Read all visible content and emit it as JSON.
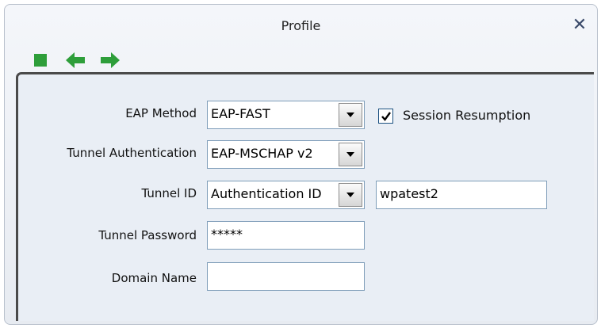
{
  "window": {
    "title": "Profile",
    "close_label": "✕"
  },
  "form": {
    "eap_method": {
      "label": "EAP Method",
      "value": "EAP-FAST"
    },
    "session_resumption": {
      "label": "Session Resumption",
      "checked": true
    },
    "tunnel_authentication": {
      "label": "Tunnel Authentication",
      "value": "EAP-MSCHAP v2"
    },
    "tunnel_id": {
      "label": "Tunnel ID",
      "type_value": "Authentication ID",
      "value": "wpatest2"
    },
    "tunnel_password": {
      "label": "Tunnel Password",
      "value": "*****"
    },
    "domain_name": {
      "label": "Domain Name",
      "value": ""
    }
  },
  "colors": {
    "toolbar_green": "#2e9e3a",
    "panel_bg": "#e9eef5"
  }
}
